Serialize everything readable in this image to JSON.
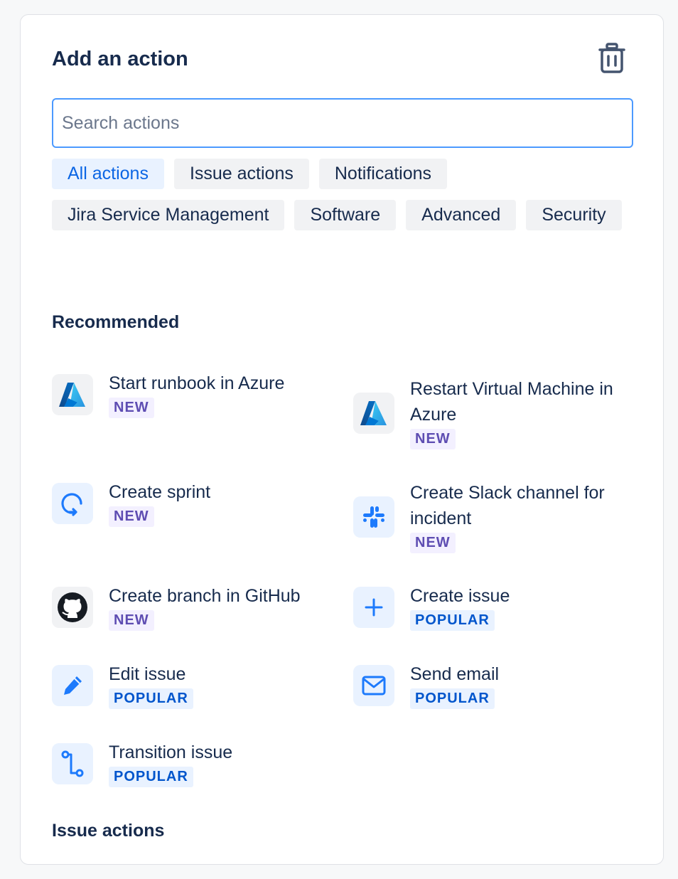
{
  "panel": {
    "title": "Add an action",
    "delete_icon": "trash-icon"
  },
  "search": {
    "value": "",
    "placeholder": "Search actions"
  },
  "filters": [
    {
      "label": "All actions",
      "active": true
    },
    {
      "label": "Issue actions",
      "active": false
    },
    {
      "label": "Notifications",
      "active": false
    },
    {
      "label": "Jira Service Management",
      "active": false
    },
    {
      "label": "Software",
      "active": false
    },
    {
      "label": "Advanced",
      "active": false
    },
    {
      "label": "Security",
      "active": false
    }
  ],
  "sections": {
    "recommended": "Recommended",
    "issue_actions": "Issue actions"
  },
  "actions": [
    {
      "name": "Start runbook in Azure",
      "badge": "NEW",
      "icon": "azure-logo-icon"
    },
    {
      "name": "Restart Virtual Machine in Azure",
      "badge": "NEW",
      "icon": "azure-logo-icon"
    },
    {
      "name": "Create sprint",
      "badge": "NEW",
      "icon": "sprint-icon"
    },
    {
      "name": "Create Slack channel for incident",
      "badge": "NEW",
      "icon": "slack-logo-icon"
    },
    {
      "name": "Create branch in GitHub",
      "badge": "NEW",
      "icon": "github-logo-icon"
    },
    {
      "name": "Create issue",
      "badge": "POPULAR",
      "icon": "plus-icon"
    },
    {
      "name": "Edit issue",
      "badge": "POPULAR",
      "icon": "pencil-icon"
    },
    {
      "name": "Send email",
      "badge": "POPULAR",
      "icon": "email-icon"
    },
    {
      "name": "Transition issue",
      "badge": "POPULAR",
      "icon": "transition-icon"
    }
  ],
  "colors": {
    "accent": "#0c66e4",
    "icon_blue": "#1d7afc",
    "new_badge_bg": "#f3f0ff",
    "new_badge_text": "#5e4db2",
    "popular_badge_bg": "#e9f2ff",
    "popular_badge_text": "#0055cc"
  }
}
